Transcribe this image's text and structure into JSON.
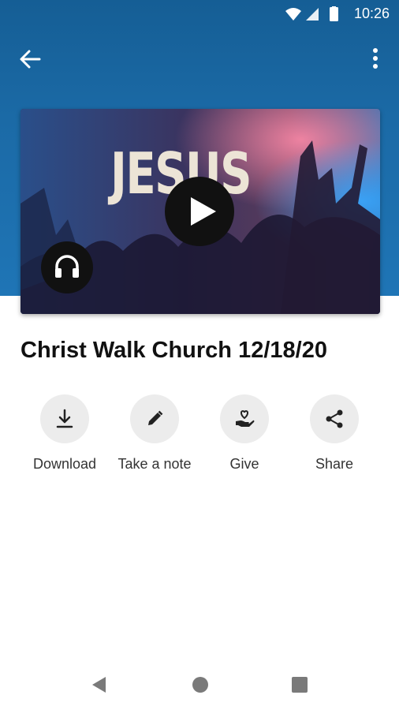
{
  "status_bar": {
    "time": "10:26",
    "icons": [
      "wifi-icon",
      "signal-icon",
      "battery-icon"
    ]
  },
  "app_bar": {
    "back_icon": "arrow-back-icon",
    "menu_icon": "more-vert-icon"
  },
  "media": {
    "thumbnail_text": "JESUS",
    "play_icon": "play-icon",
    "audio_icon": "headphones-icon"
  },
  "title": "Christ Walk Church 12/18/20",
  "actions": [
    {
      "label": "Download",
      "icon": "download-icon"
    },
    {
      "label": "Take a note",
      "icon": "pencil-icon"
    },
    {
      "label": "Give",
      "icon": "give-heart-hand-icon"
    },
    {
      "label": "Share",
      "icon": "share-icon"
    }
  ],
  "navigation_bar": [
    "back-triangle-icon",
    "home-circle-icon",
    "recents-square-icon"
  ],
  "colors": {
    "header_blue": "#1b6aa6",
    "action_circle": "#ececec",
    "text_dark": "#111111"
  }
}
